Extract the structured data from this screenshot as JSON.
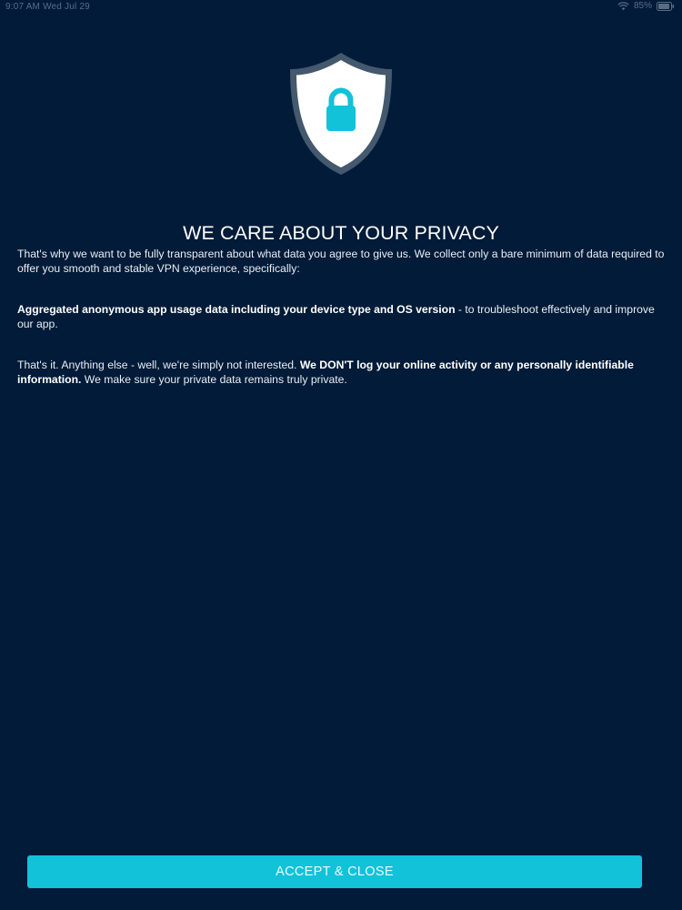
{
  "status_bar": {
    "time_date": "9:07 AM   Wed Jul 29",
    "battery_text": "85%"
  },
  "icons": {
    "shield": "shield-lock-icon",
    "wifi": "wifi-icon",
    "battery": "battery-icon"
  },
  "title": "WE CARE ABOUT YOUR PRIVACY",
  "paragraphs": {
    "intro": "That's why we want to be fully transparent about what data you agree to give us. We collect only a bare minimum of data required to offer you smooth and stable VPN experience, specifically:",
    "usage_bold": "Aggregated anonymous app usage data including your device type and OS version",
    "usage_rest": " - to troubleshoot effectively and improve our app.",
    "closing_start": "That's it. Anything else - well, we're simply not interested. ",
    "closing_bold": "We DON'T log your online activity or any personally identifiable information.",
    "closing_end": " We make sure your private data remains truly private."
  },
  "accept_button": {
    "label": "ACCEPT & CLOSE"
  },
  "colors": {
    "background": "#021b38",
    "accent": "#12c2d9",
    "shield_fill": "#ffffff",
    "shield_border": "#44586e"
  }
}
